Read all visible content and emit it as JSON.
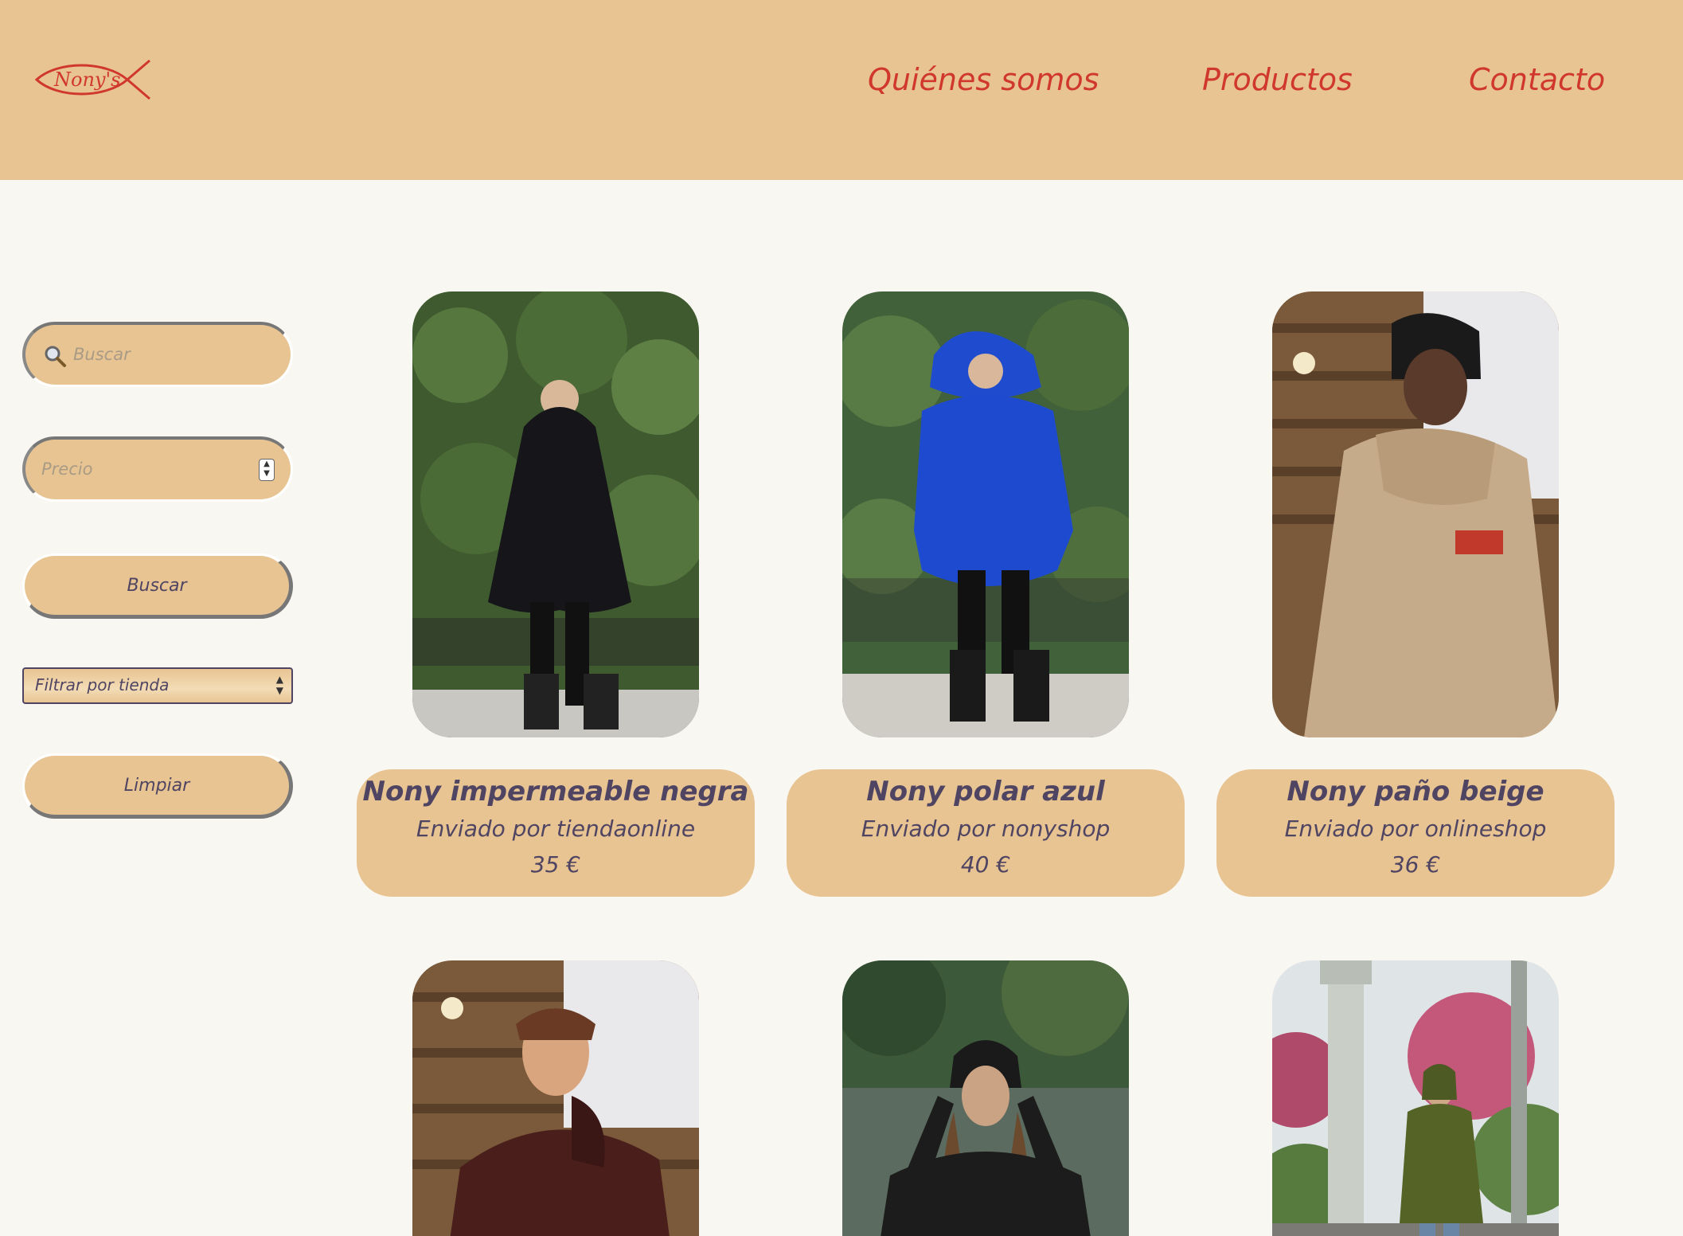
{
  "header": {
    "logo_text": "Nony's",
    "nav": [
      "Quiénes somos",
      "Productos",
      "Contacto"
    ]
  },
  "sidebar": {
    "search_placeholder": "Buscar",
    "price_placeholder": "Precio",
    "search_button": "Buscar",
    "filter_select": "Filtrar por tienda",
    "clear_button": "Limpiar"
  },
  "products": [
    {
      "name": "Nony impermeable negra",
      "shop": "Enviado por tiendaonline",
      "price": "35 €"
    },
    {
      "name": "Nony polar azul",
      "shop": "Enviado por nonyshop",
      "price": "40 €"
    },
    {
      "name": "Nony paño beige",
      "shop": "Enviado por onlineshop",
      "price": "36 €"
    }
  ],
  "colors": {
    "header_bg": "#e8c492",
    "accent_red": "#d0382b",
    "text_purple": "#4f4563",
    "page_bg": "#f9f7f2"
  }
}
